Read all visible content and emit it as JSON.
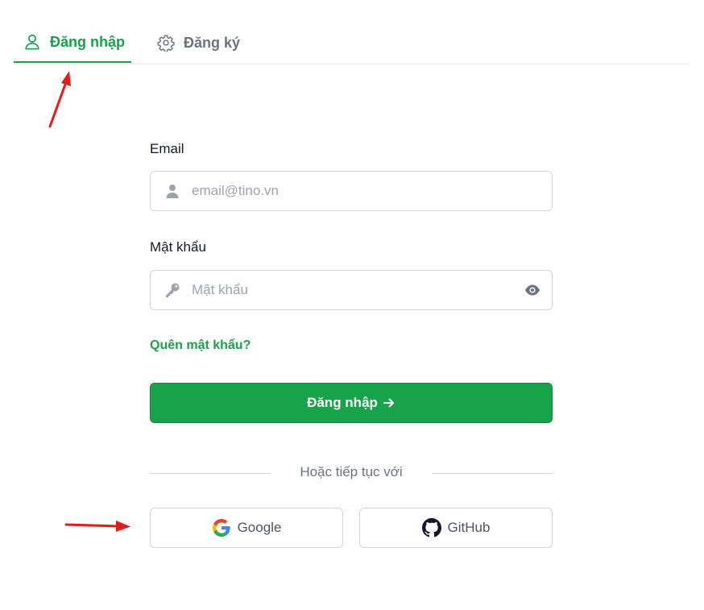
{
  "tabs": {
    "login": {
      "label": "Đăng nhập",
      "icon": "user-icon"
    },
    "register": {
      "label": "Đăng ký",
      "icon": "gear-icon"
    }
  },
  "form": {
    "email": {
      "label": "Email",
      "placeholder": "email@tino.vn",
      "icon": "user-icon"
    },
    "password": {
      "label": "Mật khẩu",
      "placeholder": "Mật khẩu",
      "icon": "key-icon",
      "toggle_icon": "eye-icon"
    },
    "forgot_label": "Quên mật khẩu?",
    "submit_label": "Đăng nhập",
    "divider_text": "Hoặc tiếp tục với"
  },
  "social": {
    "google_label": "Google",
    "github_label": "GitHub"
  },
  "colors": {
    "accent": "#16a34a",
    "annotation_arrow": "#e11d1d"
  }
}
